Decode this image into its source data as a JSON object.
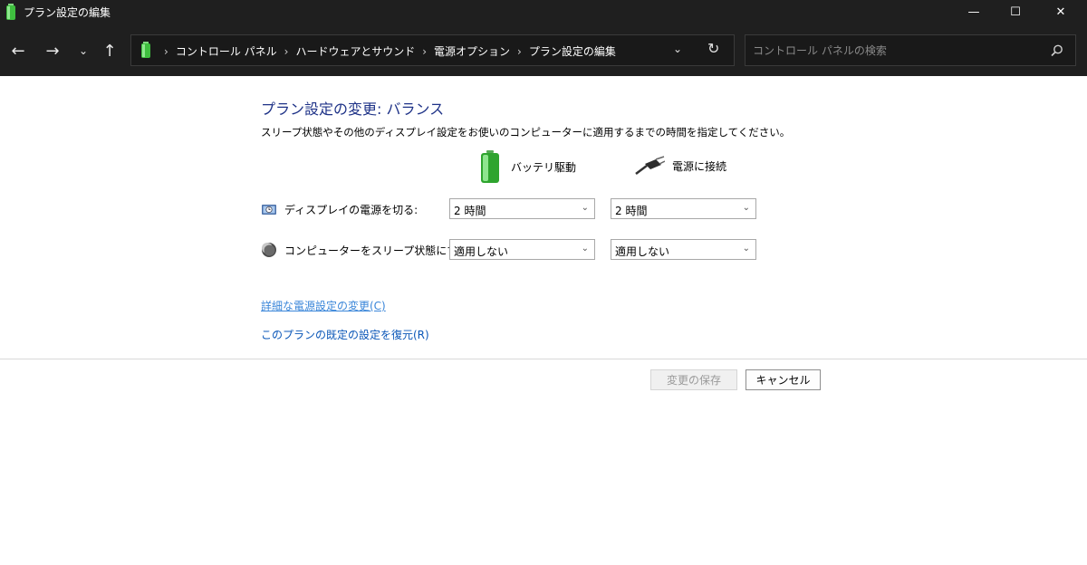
{
  "window": {
    "title": "プラン設定の編集",
    "min_glyph": "—",
    "max_glyph": "☐",
    "close_glyph": "✕"
  },
  "nav": {
    "back": "←",
    "forward": "→",
    "recent": "⌄",
    "up": "↑"
  },
  "address": {
    "crumbs": [
      "コントロール パネル",
      "ハードウェアとサウンド",
      "電源オプション",
      "プラン設定の編集"
    ],
    "separator": "›",
    "dropdown": "⌄",
    "refresh": "↻"
  },
  "search": {
    "placeholder": "コントロール パネルの検索",
    "value": ""
  },
  "main": {
    "heading": "プラン設定の変更: バランス",
    "description": "スリープ状態やその他のディスプレイ設定をお使いのコンピューターに適用するまでの時間を指定してください。",
    "col_battery": "バッテリ駆動",
    "col_plugged": "電源に接続",
    "rows": [
      {
        "label": "ディスプレイの電源を切る:",
        "battery": "2 時間",
        "plugged": "2 時間"
      },
      {
        "label": "コンピューターをスリープ状態にする:",
        "battery": "適用しない",
        "plugged": "適用しない"
      }
    ],
    "chevron": "⌄",
    "link_advanced": "詳細な電源設定の変更(C)",
    "link_restore": "このプランの既定の設定を復元(R)",
    "save_label": "変更の保存",
    "cancel_label": "キャンセル"
  },
  "colors": {
    "titlebar": "#1f1f1f",
    "heading": "#1e3287",
    "link": "#3a86d9",
    "battery_green": "#3fbf3f"
  }
}
